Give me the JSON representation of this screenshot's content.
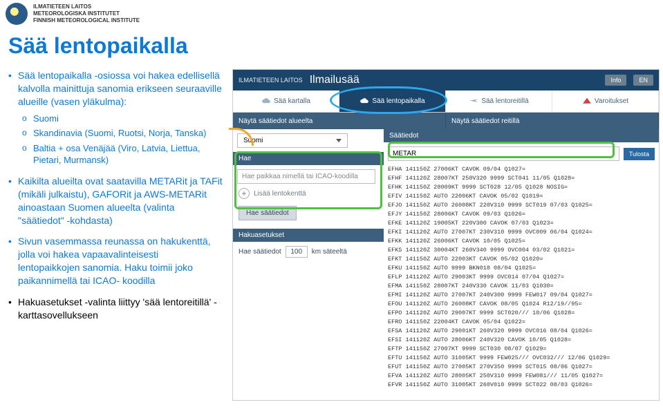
{
  "institute": {
    "line1": "ILMATIETEEN LAITOS",
    "line2": "METEOROLOGISKA INSTITUTET",
    "line3": "FINNISH METEOROLOGICAL INSTITUTE"
  },
  "title": "Sää lentopaikalla",
  "left": {
    "b1": "Sää lentopaikalla -osiossa voi hakea edellisellä kalvolla mainittuja sanomia erikseen seuraaville alueille (vasen yläkulma):",
    "regions": {
      "r1": "Suomi",
      "r2": "Skandinavia (Suomi, Ruotsi, Norja, Tanska)",
      "r3": "Baltia + osa Venäjää (Viro, Latvia, Liettua, Pietari, Murmansk)"
    },
    "b2": "Kaikilta alueilta ovat saatavilla METARit ja TAFit (mikäli julkaistu), GAFORit ja AWS-METARit ainoastaan Suomen alueelta (valinta \"säätiedot\" -kohdasta)",
    "b3": "Sivun vasemmassa reunassa on hakukenttä, jolla voi hakea vapaavalinteisesti lentopaikkojen sanomia. Haku toimii joko paikannimellä tai ICAO- koodilla",
    "b4": "Hakuasetukset -valinta liittyy 'sää lentoreitillä' -karttasovellukseen"
  },
  "app": {
    "org": "ILMATIETEEN LAITOS",
    "brand": "Ilmailusää",
    "info": "Info",
    "lang": "EN",
    "tabs": {
      "t1": "Sää kartalla",
      "t2": "Sää lentopaikalla",
      "t3": "Sää lentoreitillä",
      "t4": "Varoitukset"
    },
    "midL": "Näytä säätiedot alueelta",
    "midR": "Näytä säätiedot reitillä",
    "region_selected": "Suomi",
    "hae_label": "Hae",
    "search_placeholder": "Hae paikkaa nimellä tai ICAO-koodilla",
    "add_airport": "Lisää lentokenttä",
    "hae_saatiedot": "Hae säätiedot",
    "hakuasetukset": "Hakuasetukset",
    "haku_line_a": "Hae säätiedot",
    "haku_val": "100",
    "haku_line_b": "km säteeltä",
    "saatiedot_label": "Säätiedot",
    "metar": "METAR",
    "print": "Tulosta",
    "lines": [
      "EFHA 141150Z 27006KT CAVOK 09/04 Q1027=",
      "EFHF 141120Z 28007KT 250V320 9999 SCT041 11/05 Q1028=",
      "EFHK 141150Z 28009KT 9999 SCT028 12/05 Q1028 NOSIG=",
      "EFIV 141150Z AUTO 22006KT CAVOK 05/02 Q1019=",
      "EFJO 141150Z AUTO 26008KT 220V310 9999 SCT019 07/03 Q1025=",
      "EFJY 141150Z 28006KT CAVOK 09/03 Q1026=",
      "EFKE 141120Z 19005KT 220V300 CAVOK 07/03 Q1023=",
      "EFKI 141120Z AUTO 27007KT 230V310 9999 OVC009 06/04 Q1024=",
      "EFKK 141120Z 26006KT CAVOK 10/05 Q1025=",
      "EFKS 141120Z 30004KT 260V340 9999 OVC004 03/02 Q1021=",
      "EFKT 141150Z AUTO 22003KT CAVOK 05/02 Q1020=",
      "EFKU 141150Z AUTO 9999 BKN018 08/04 Q1025=",
      "EFLP 141120Z AUTO 29003KT 9999 OVC014 07/04 Q1027=",
      "EFMA 141150Z 28007KT 240V330 CAVOK 11/03 Q1030=",
      "EFMI 141120Z AUTO 27007KT 240V300 9999 FEW017 09/04 Q1027=",
      "EFOU 141120Z AUTO 26008KT CAVOK 08/05 Q1024 R12/19//95=",
      "EFPO 141120Z AUTO 29007KT 9999 SCT020/// 10/06 Q1028=",
      "EFRO 141150Z 22004KT CAVOK 05/04 Q1022=",
      "EFSA 141120Z AUTO 29001KT 260V320 9999 OVC016 08/04 Q1026=",
      "EFSI 141120Z AUTO 28006KT 240V320 CAVOK 10/05 Q1028=",
      "EFTP 141150Z 27007KT 9999 SCT030 08/07 Q1029=",
      "EFTU 141150Z AUTO 31005KT 9999 FEW025/// OVC032/// 12/06 Q1029=",
      "EFUT 141150Z AUTO 27005KT 270V350 9999 SCT015 08/06 Q1027=",
      "EFVA 141120Z AUTO 28005KT 250V310 9999 FEW081/// 11/05 Q1027=",
      "EFVR 141150Z AUTO 31005KT 260V010 9999 SCT022 08/03 Q1026="
    ]
  }
}
